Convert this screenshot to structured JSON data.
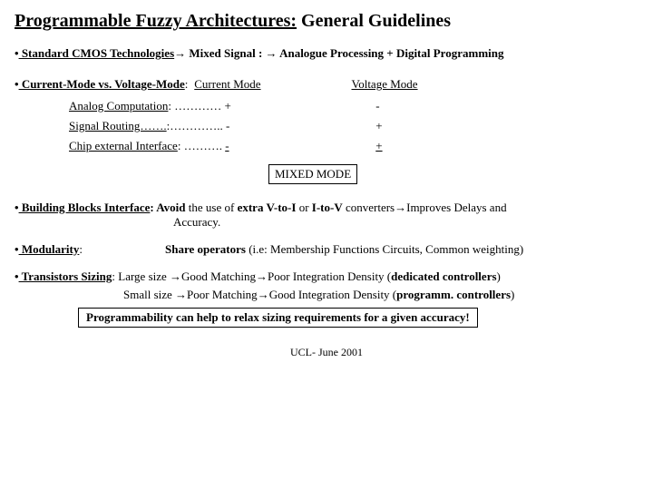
{
  "title": {
    "main": "Programmable Fuzzy Architectures:",
    "sub": " General Guidelines"
  },
  "arrow": "→",
  "line_cmos": {
    "lead": " Standard CMOS Technologies",
    "after": " Mixed Signal : ",
    "tail": " Analogue Processing +  Digital Programming"
  },
  "modes": {
    "label": " Current-Mode vs. Voltage-Mode",
    "col1": "Current Mode",
    "col2": "Voltage Mode",
    "rows": [
      {
        "attr": "Analog Computation",
        "dots": ": ………… ",
        "c1": "+",
        "c2": "-"
      },
      {
        "attr": "Signal Routing…….",
        "dots": ":………….. ",
        "c1": "-",
        "c2": "+"
      },
      {
        "attr": "Chip external Interface",
        "dots": ": ………. ",
        "c1": "-",
        "c2": "+"
      }
    ],
    "mixed": "MIXED MODE"
  },
  "bblock": {
    "lead": " Building Blocks Interface",
    "t1": ":   Avoid",
    "t2": " the use of ",
    "t3": "extra V-to-I",
    "t4": " or ",
    "t5": "I-to-V",
    "t6": " converters",
    "t7": "Improves Delays and",
    "t8": "Accuracy."
  },
  "mod": {
    "lead": " Modularity",
    "gap": ":                            ",
    "b": "Share operators",
    "rest": " (i.e: Membership Functions Circuits, Common weighting)"
  },
  "trans": {
    "lead": " Transistors Sizing",
    "t1": ":  Large size ",
    "t2": "Good Matching",
    "t3": "Poor Integration Density (",
    "t4": "dedicated controllers",
    "t5": ")",
    "s1": "Small size ",
    "s2": "Poor Matching",
    "s3": "Good Integration Density (",
    "s4": "programm. controllers",
    "s5": ")"
  },
  "progbox": "Programmability can help to relax sizing requirements for a given accuracy!",
  "footer": "UCL- June 2001"
}
